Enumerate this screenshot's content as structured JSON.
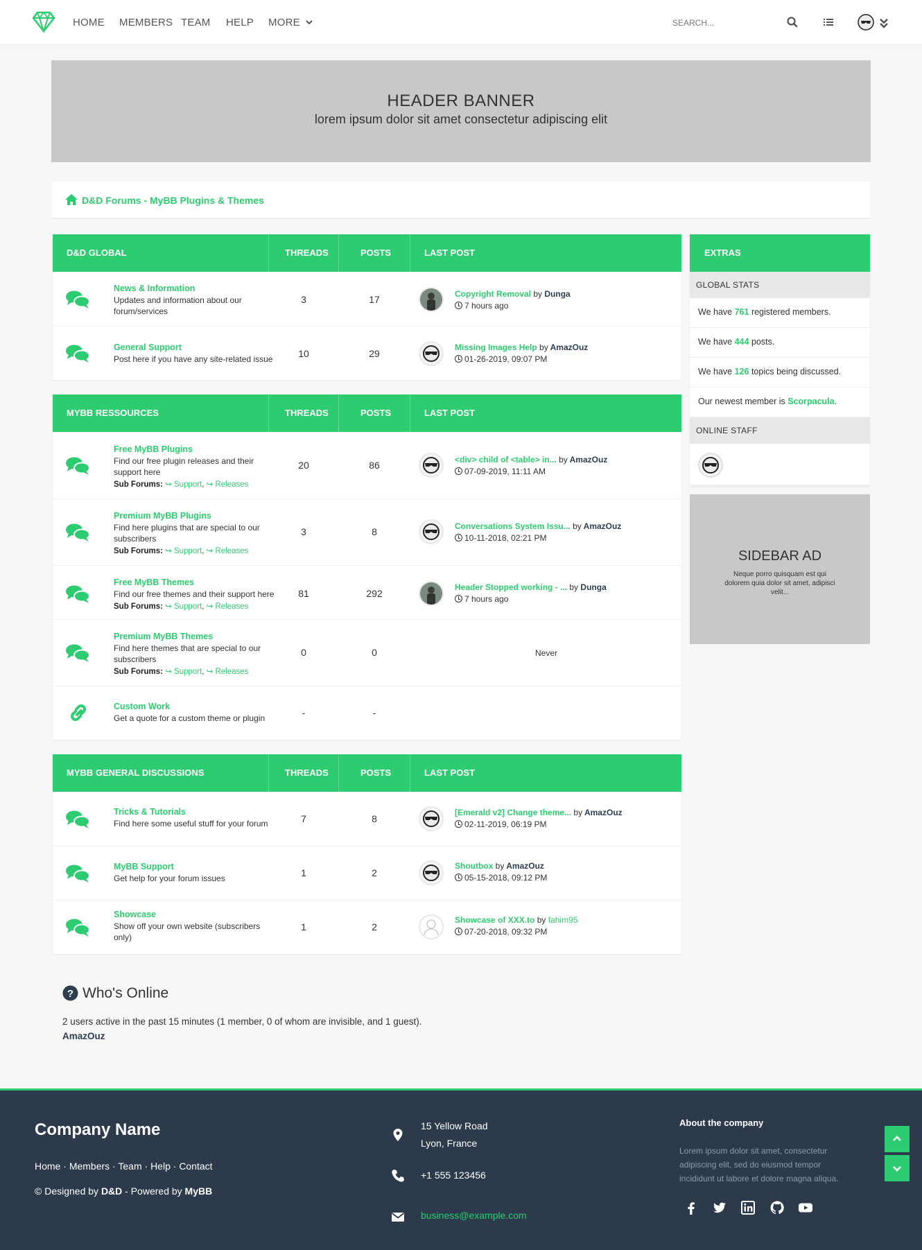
{
  "colors": {
    "accent": "#2ecc71",
    "footer_bg": "#2c3a4c",
    "text": "#333333",
    "dark_user": "#2c3e50"
  },
  "nav": {
    "items": [
      "HOME",
      "MEMBERS",
      "TEAM",
      "HELP",
      "MORE"
    ],
    "search_placeholder": "SEARCH..."
  },
  "banner": {
    "title": "HEADER BANNER",
    "subtitle": "lorem ipsum dolor sit amet consectetur adipiscing elit"
  },
  "breadcrumb": {
    "text": "D&D Forums - MyBB Plugins & Themes"
  },
  "columns": {
    "threads": "THREADS",
    "posts": "POSTS",
    "last_post": "LAST POST"
  },
  "categories": [
    {
      "name": "D&D GLOBAL",
      "forums": [
        {
          "title": "News & Information",
          "desc": "Updates and information about our forum/services",
          "threads": "3",
          "posts": "17",
          "lp_title": "Copyright Removal",
          "lp_by": "by",
          "lp_user": "Dunga",
          "lp_date": "7 hours ago"
        },
        {
          "title": "General Support",
          "desc": "Post here if you have any site-related issue",
          "threads": "10",
          "posts": "29",
          "lp_title": "Missing Images Help",
          "lp_by": "by",
          "lp_user": "AmazOuz",
          "lp_date": "01-26-2019, 09:07 PM"
        }
      ]
    },
    {
      "name": "MYBB RESSOURCES",
      "forums": [
        {
          "title": "Free MyBB Plugins",
          "desc": "Find our free plugin releases and their support here",
          "sub_label": "Sub Forums:",
          "sub1": "Support",
          "sub2": "Releases",
          "threads": "20",
          "posts": "86",
          "lp_title": "<div> child of <table> in...",
          "lp_by": "by",
          "lp_user": "AmazOuz",
          "lp_date": "07-09-2019, 11:11 AM"
        },
        {
          "title": "Premium MyBB Plugins",
          "desc": "Find here plugins that are special to our subscribers",
          "sub_label": "Sub Forums:",
          "sub1": "Support",
          "sub2": "Releases",
          "threads": "3",
          "posts": "8",
          "lp_title": "Conversations System Issu...",
          "lp_by": "by",
          "lp_user": "AmazOuz",
          "lp_date": "10-11-2018, 02:21 PM"
        },
        {
          "title": "Free MyBB Themes",
          "desc": "Find our free themes and their support here",
          "sub_label": "Sub Forums:",
          "sub1": "Support",
          "sub2": "Releases",
          "threads": "81",
          "posts": "292",
          "lp_title": "Header Stopped working - ...",
          "lp_by": "by",
          "lp_user": "Dunga",
          "lp_date": "7 hours ago"
        },
        {
          "title": "Premium MyBB Themes",
          "desc": "Find here themes that are special to our subscribers",
          "sub_label": "Sub Forums:",
          "sub1": "Support",
          "sub2": "Releases",
          "threads": "0",
          "posts": "0",
          "lp_never": "Never"
        },
        {
          "title": "Custom Work",
          "desc": "Get a quote for a custom theme or plugin",
          "threads": "-",
          "posts": "-"
        }
      ]
    },
    {
      "name": "MYBB GENERAL DISCUSSIONS",
      "forums": [
        {
          "title": "Tricks & Tutorials",
          "desc": "Find here some useful stuff for your forum",
          "threads": "7",
          "posts": "8",
          "lp_title": "[Emerald v2] Change theme...",
          "lp_by": "by",
          "lp_user": "AmazOuz",
          "lp_date": "02-11-2019, 06:19 PM"
        },
        {
          "title": "MyBB Support",
          "desc": "Get help for your forum issues",
          "threads": "1",
          "posts": "2",
          "lp_title": "Shoutbox",
          "lp_by": "by",
          "lp_user": "AmazOuz",
          "lp_date": "05-15-2018, 09:12 PM"
        },
        {
          "title": "Showcase",
          "desc": "Show off your own website (subscribers only)",
          "threads": "1",
          "posts": "2",
          "lp_title": "Showcase of XXX.to",
          "lp_by": "by",
          "lp_user": "fahim95",
          "lp_date": "07-20-2018, 09:32 PM"
        }
      ]
    }
  ],
  "sidebar": {
    "title": "EXTRAS",
    "global_stats": "GLOBAL STATS",
    "stats": [
      {
        "pre": "We have",
        "num": "761",
        "post": "registered members."
      },
      {
        "pre": "We have",
        "num": "444",
        "post": "posts."
      },
      {
        "pre": "We have",
        "num": "126",
        "post": "topics being discussed."
      },
      {
        "pre": "Our newest member is",
        "num": "Scorpacula",
        "post": "."
      }
    ],
    "online_staff": "ONLINE STAFF",
    "ad_title": "SIDEBAR AD",
    "ad_text": "Neque porro quisquam est qui dolorem quia dolor sit amet, adipisci velit..."
  },
  "whos_online": {
    "title": "Who's Online",
    "text": "2 users active in the past 15 minutes (1 member, 0 of whom are invisible, and 1 guest).",
    "user": "AmazOuz"
  },
  "footer": {
    "company": "Company Name",
    "links": [
      "Home",
      "Members",
      "Team",
      "Help",
      "Contact"
    ],
    "credit_pre": "© Designed by",
    "credit_dd": "D&D",
    "credit_mid": "- Powered by",
    "credit_mybb": "MyBB",
    "address1": "15 Yellow Road",
    "address2": "Lyon, France",
    "phone": "+1 555 123456",
    "email": "business@example.com",
    "about_title": "About the company",
    "about_text": "Lorem ipsum dolor sit amet, consectetur adipiscing elit, sed do eiusmod tempor incididunt ut labore et dolore magna aliqua.",
    "social_icons": [
      "facebook-icon",
      "twitter-icon",
      "linkedin-icon",
      "github-icon",
      "youtube-icon"
    ]
  }
}
